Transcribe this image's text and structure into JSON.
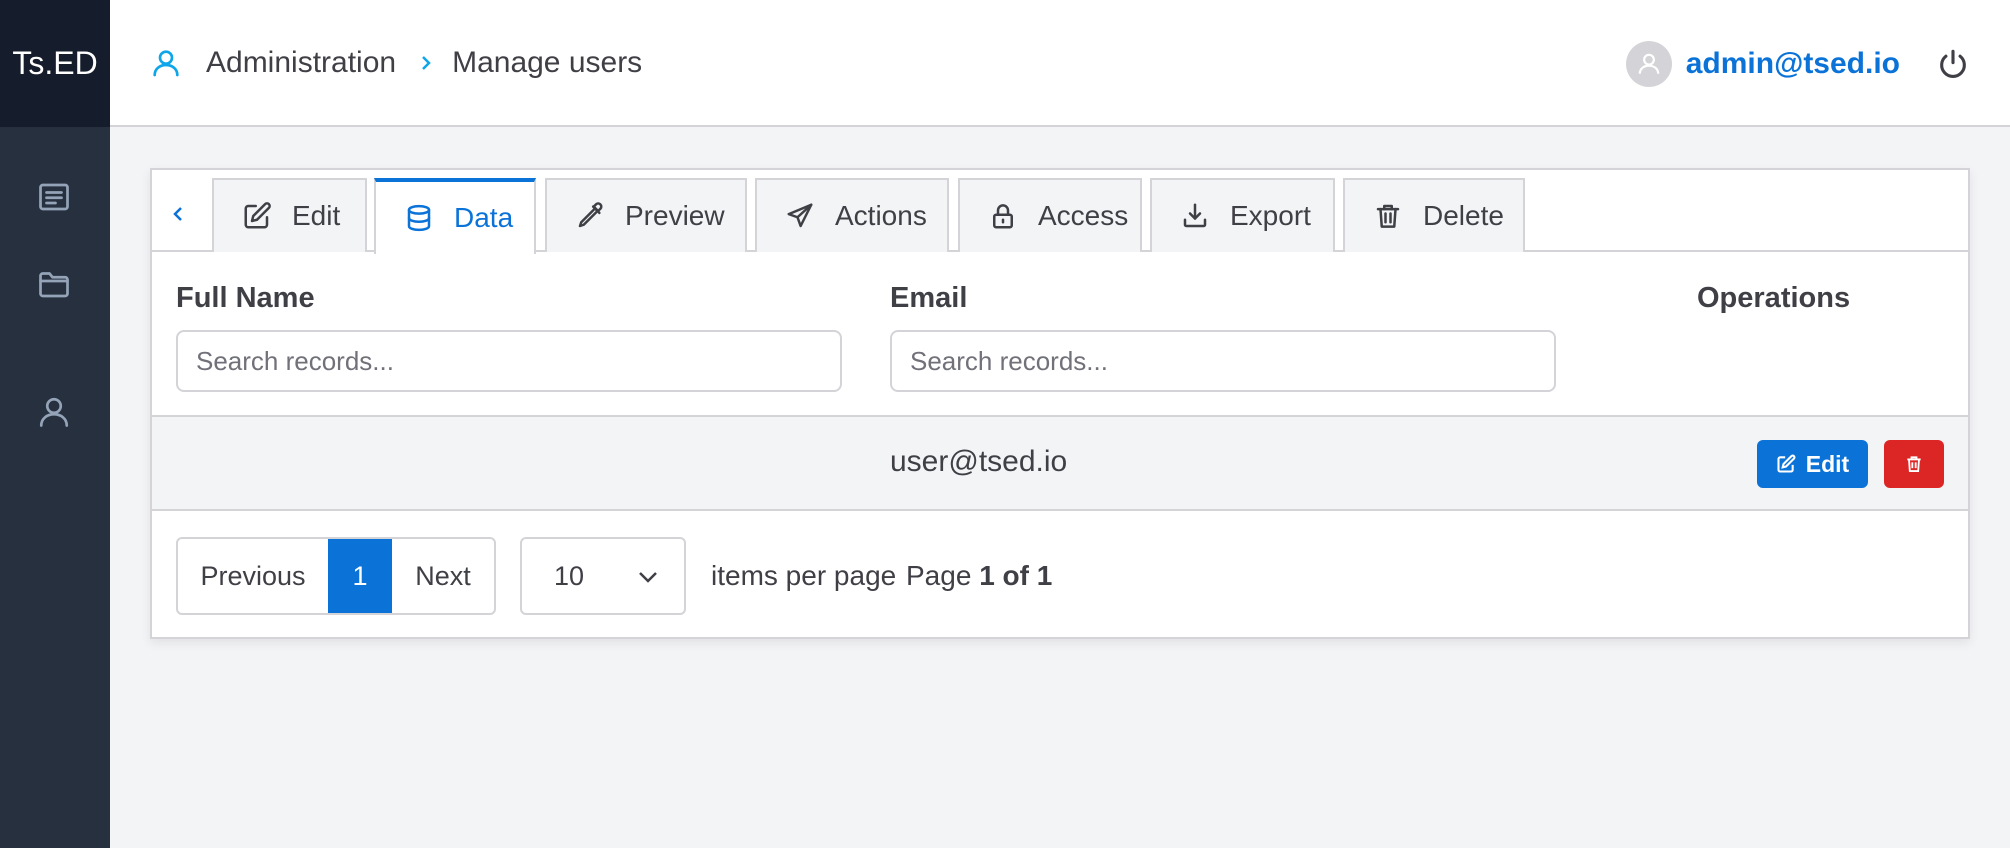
{
  "brand": "Ts.ED",
  "sidebar": {
    "items": [
      {
        "icon": "list-icon"
      },
      {
        "icon": "folder-icon"
      },
      {
        "icon": "user-icon"
      }
    ]
  },
  "header": {
    "breadcrumb": [
      "Administration",
      "Manage users"
    ],
    "user_email": "admin@tsed.io"
  },
  "tabs": [
    {
      "label": "Edit",
      "icon": "edit-icon"
    },
    {
      "label": "Data",
      "icon": "database-icon",
      "active": true
    },
    {
      "label": "Preview",
      "icon": "eyedropper-icon"
    },
    {
      "label": "Actions",
      "icon": "send-icon"
    },
    {
      "label": "Access",
      "icon": "lock-icon"
    },
    {
      "label": "Export",
      "icon": "download-icon"
    },
    {
      "label": "Delete",
      "icon": "trash-icon"
    }
  ],
  "table": {
    "columns": [
      "Full Name",
      "Email",
      "Operations"
    ],
    "search_placeholder": "Search records...",
    "rows": [
      {
        "full_name": "",
        "email": "user@tsed.io",
        "edit_label": "Edit"
      }
    ]
  },
  "pagination": {
    "previous": "Previous",
    "current": "1",
    "next": "Next",
    "per_page": "10",
    "per_page_label": "items per page",
    "page_prefix": "Page",
    "page_of": "1 of 1"
  },
  "colors": {
    "accent": "#0b73d8",
    "danger": "#dc2626",
    "sidebar": "#26303f"
  }
}
